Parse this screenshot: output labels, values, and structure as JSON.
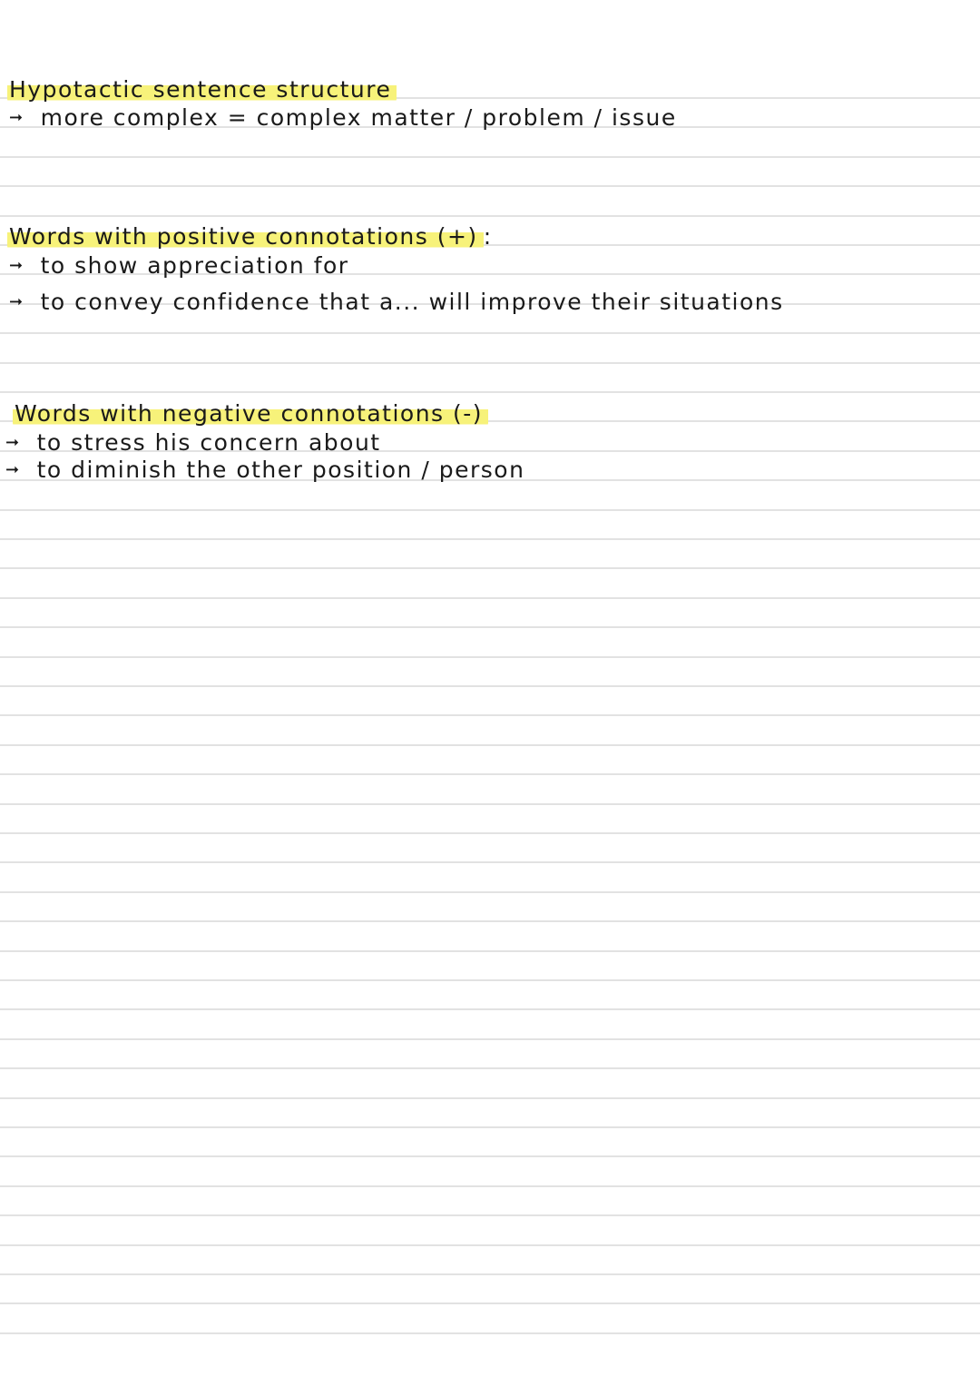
{
  "page": {
    "paper": "lined notebook page",
    "colors": {
      "ink": "#1a1a1a",
      "highlight": "#f7f27a",
      "rule": "#e2e2e2",
      "paper": "#ffffff"
    }
  },
  "sections": [
    {
      "heading": "Hypotactic sentence structure",
      "heading_suffix": "",
      "bullets": [
        {
          "icon": "arrow-right-icon",
          "text": "more complex = complex matter / problem / issue"
        }
      ]
    },
    {
      "heading": "Words with positive connotations (+)",
      "heading_suffix": ":",
      "bullets": [
        {
          "icon": "arrow-right-icon",
          "text": "to show appreciation for"
        },
        {
          "icon": "arrow-right-icon",
          "text": "to convey confidence that a... will improve their situations"
        }
      ]
    },
    {
      "heading": "Words with negative connotations (-)",
      "heading_suffix": "",
      "bullets": [
        {
          "icon": "arrow-right-icon",
          "text": "to stress his concern about"
        },
        {
          "icon": "arrow-right-icon",
          "text": "to diminish the other position / person"
        }
      ]
    }
  ],
  "arrow_glyph": "➞"
}
